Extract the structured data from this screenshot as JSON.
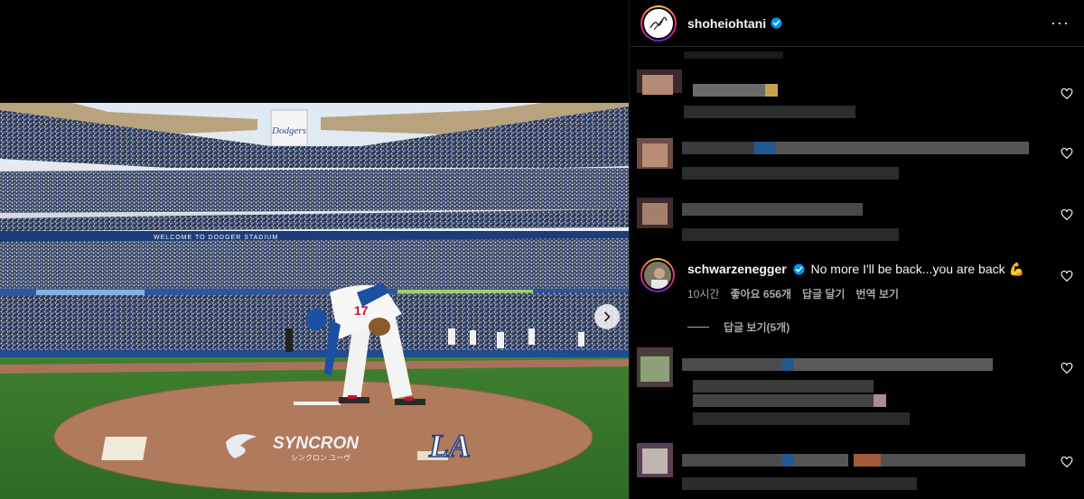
{
  "post": {
    "author": "shoheiohtani",
    "more_label": "···"
  },
  "media": {
    "next_icon": "chevron-right-icon",
    "ad_text": "SYNCRON",
    "ad_subtext": "シンクロン ユーヴ",
    "banner_text": "WELCOME TO DODGER STADIUM",
    "sign_text": "Dodgers",
    "jersey_number": "17"
  },
  "comment": {
    "user": "schwarzenegger",
    "text": "No more I'll be back...you are back 💪",
    "time": "10시간",
    "likes": "좋아요 656개",
    "reply": "답글 달기",
    "translate": "번역 보기"
  },
  "view_replies": "답글 보기(5개)",
  "colors": {
    "background": "#000000",
    "text": "#f5f5f5",
    "muted": "#a8a8a8",
    "verified": "#0095f6"
  }
}
